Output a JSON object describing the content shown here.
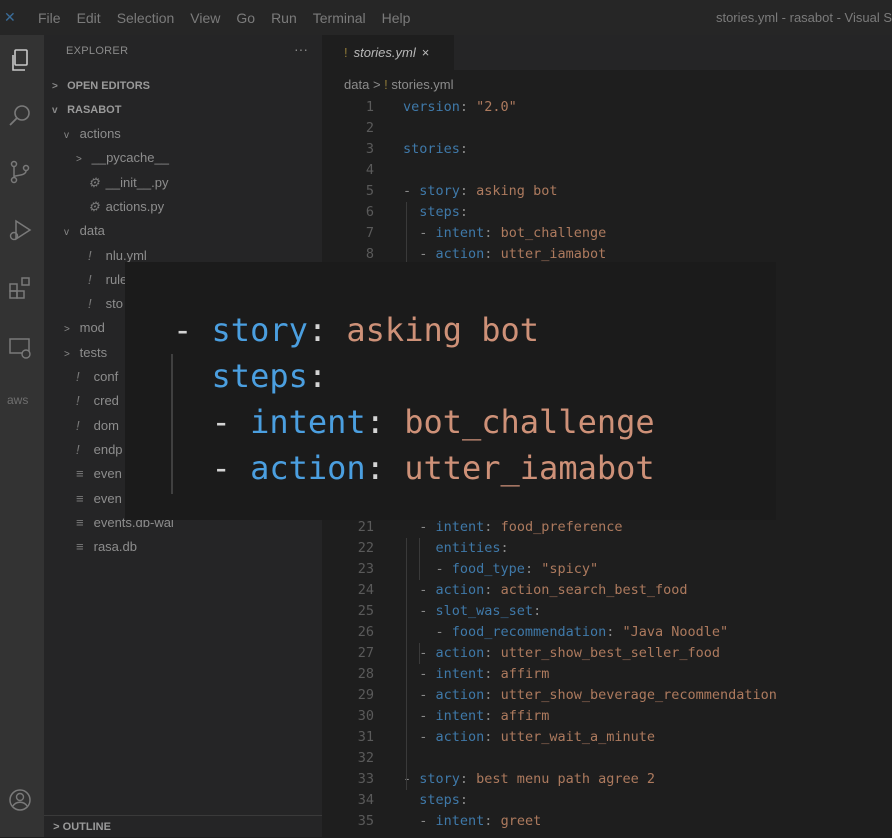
{
  "titlebar": {
    "menus": [
      "File",
      "Edit",
      "Selection",
      "View",
      "Go",
      "Run",
      "Terminal",
      "Help"
    ],
    "window_title": "stories.yml - rasabot - Visual S"
  },
  "activity_icons": [
    "explorer-icon",
    "search-icon",
    "source-control-icon",
    "run-debug-icon",
    "extensions-icon",
    "remote-explorer-icon",
    "aws-icon",
    "account-icon"
  ],
  "activity_aws_label": "aws",
  "explorer": {
    "header": "EXPLORER",
    "more": "···",
    "open_editors": "OPEN EDITORS",
    "root": "RASABOT",
    "outline": "OUTLINE",
    "items": [
      {
        "label": "actions",
        "twisty": "v",
        "icon": "",
        "indent": 1
      },
      {
        "label": "__pycache__",
        "twisty": ">",
        "icon": "",
        "indent": 2
      },
      {
        "label": "__init__.py",
        "twisty": "",
        "icon": "py",
        "indent": 2
      },
      {
        "label": "actions.py",
        "twisty": "",
        "icon": "py",
        "indent": 2
      },
      {
        "label": "data",
        "twisty": "v",
        "icon": "",
        "indent": 1
      },
      {
        "label": "nlu.yml",
        "twisty": "",
        "icon": "!",
        "indent": 2
      },
      {
        "label": "rule",
        "twisty": "",
        "icon": "!",
        "indent": 2
      },
      {
        "label": "sto",
        "twisty": "",
        "icon": "!",
        "indent": 2
      },
      {
        "label": "mod",
        "twisty": ">",
        "icon": "",
        "indent": 1
      },
      {
        "label": "tests",
        "twisty": ">",
        "icon": "",
        "indent": 1
      },
      {
        "label": "conf",
        "twisty": "",
        "icon": "!",
        "indent": 1
      },
      {
        "label": "cred",
        "twisty": "",
        "icon": "!",
        "indent": 1
      },
      {
        "label": "dom",
        "twisty": "",
        "icon": "!",
        "indent": 1
      },
      {
        "label": "endp",
        "twisty": "",
        "icon": "!",
        "indent": 1
      },
      {
        "label": "even",
        "twisty": "",
        "icon": "≡",
        "indent": 1
      },
      {
        "label": "even",
        "twisty": "",
        "icon": "≡",
        "indent": 1
      },
      {
        "label": "events.db-wal",
        "twisty": "",
        "icon": "≡",
        "indent": 1
      },
      {
        "label": "rasa.db",
        "twisty": "",
        "icon": "≡",
        "indent": 1
      }
    ]
  },
  "tab": {
    "icon": "!",
    "label": "stories.yml",
    "close": "×"
  },
  "breadcrumb": {
    "folder": "data",
    "sep": ">",
    "icon": "!",
    "file": "stories.yml"
  },
  "code_lines": [
    {
      "n": "1",
      "parts": [
        [
          "k",
          "version"
        ],
        [
          "d",
          ": "
        ],
        [
          "v",
          "\"2.0\""
        ]
      ]
    },
    {
      "n": "2",
      "parts": []
    },
    {
      "n": "3",
      "parts": [
        [
          "k",
          "stories"
        ],
        [
          "d",
          ":"
        ]
      ]
    },
    {
      "n": "4",
      "parts": []
    },
    {
      "n": "5",
      "parts": [
        [
          "d",
          "- "
        ],
        [
          "k",
          "story"
        ],
        [
          "d",
          ": "
        ],
        [
          "v",
          "asking bot"
        ]
      ]
    },
    {
      "n": "6",
      "parts": [
        [
          "d",
          "  "
        ],
        [
          "k",
          "steps"
        ],
        [
          "d",
          ":"
        ]
      ]
    },
    {
      "n": "7",
      "parts": [
        [
          "d",
          "  - "
        ],
        [
          "k",
          "intent"
        ],
        [
          "d",
          ": "
        ],
        [
          "v",
          "bot_challenge"
        ]
      ]
    },
    {
      "n": "8",
      "parts": [
        [
          "d",
          "  - "
        ],
        [
          "k",
          "action"
        ],
        [
          "d",
          ": "
        ],
        [
          "v",
          "utter_iamabot"
        ]
      ]
    },
    {
      "n": "21",
      "parts": [
        [
          "d",
          "  - "
        ],
        [
          "k",
          "intent"
        ],
        [
          "d",
          ": "
        ],
        [
          "v",
          "food_preference"
        ]
      ]
    },
    {
      "n": "22",
      "parts": [
        [
          "d",
          "    "
        ],
        [
          "k",
          "entities"
        ],
        [
          "d",
          ":"
        ]
      ]
    },
    {
      "n": "23",
      "parts": [
        [
          "d",
          "    - "
        ],
        [
          "k",
          "food_type"
        ],
        [
          "d",
          ": "
        ],
        [
          "v",
          "\"spicy\""
        ]
      ]
    },
    {
      "n": "24",
      "parts": [
        [
          "d",
          "  - "
        ],
        [
          "k",
          "action"
        ],
        [
          "d",
          ": "
        ],
        [
          "v",
          "action_search_best_food"
        ]
      ]
    },
    {
      "n": "25",
      "parts": [
        [
          "d",
          "  - "
        ],
        [
          "k",
          "slot_was_set"
        ],
        [
          "d",
          ":"
        ]
      ]
    },
    {
      "n": "26",
      "parts": [
        [
          "d",
          "    - "
        ],
        [
          "k",
          "food_recommendation"
        ],
        [
          "d",
          ": "
        ],
        [
          "v",
          "\"Java Noodle\""
        ]
      ]
    },
    {
      "n": "27",
      "parts": [
        [
          "d",
          "  - "
        ],
        [
          "k",
          "action"
        ],
        [
          "d",
          ": "
        ],
        [
          "v",
          "utter_show_best_seller_food"
        ]
      ]
    },
    {
      "n": "28",
      "parts": [
        [
          "d",
          "  - "
        ],
        [
          "k",
          "intent"
        ],
        [
          "d",
          ": "
        ],
        [
          "v",
          "affirm"
        ]
      ]
    },
    {
      "n": "29",
      "parts": [
        [
          "d",
          "  - "
        ],
        [
          "k",
          "action"
        ],
        [
          "d",
          ": "
        ],
        [
          "v",
          "utter_show_beverage_recommendation"
        ]
      ]
    },
    {
      "n": "30",
      "parts": [
        [
          "d",
          "  - "
        ],
        [
          "k",
          "intent"
        ],
        [
          "d",
          ": "
        ],
        [
          "v",
          "affirm"
        ]
      ]
    },
    {
      "n": "31",
      "parts": [
        [
          "d",
          "  - "
        ],
        [
          "k",
          "action"
        ],
        [
          "d",
          ": "
        ],
        [
          "v",
          "utter_wait_a_minute"
        ]
      ]
    },
    {
      "n": "32",
      "parts": []
    },
    {
      "n": "33",
      "parts": [
        [
          "d",
          "- "
        ],
        [
          "k",
          "story"
        ],
        [
          "d",
          ": "
        ],
        [
          "v",
          "best menu path agree 2"
        ]
      ]
    },
    {
      "n": "34",
      "parts": [
        [
          "d",
          "  "
        ],
        [
          "k",
          "steps"
        ],
        [
          "d",
          ":"
        ]
      ]
    },
    {
      "n": "35",
      "parts": [
        [
          "d",
          "  - "
        ],
        [
          "k",
          "intent"
        ],
        [
          "d",
          ": "
        ],
        [
          "v",
          "greet"
        ]
      ]
    }
  ],
  "zoom": {
    "lines": [
      [
        [
          "zd",
          "- "
        ],
        [
          "zk",
          "story"
        ],
        [
          "zd",
          ": "
        ],
        [
          "zv",
          "asking bot"
        ]
      ],
      [
        [
          "zd",
          "  "
        ],
        [
          "zk",
          "steps"
        ],
        [
          "zd",
          ":"
        ]
      ],
      [
        [
          "zd",
          "  - "
        ],
        [
          "zk",
          "intent"
        ],
        [
          "zd",
          ": "
        ],
        [
          "zv",
          "bot_challenge"
        ]
      ],
      [
        [
          "zd",
          "  - "
        ],
        [
          "zk",
          "action"
        ],
        [
          "zd",
          ": "
        ],
        [
          "zv",
          "utter_iamabot"
        ]
      ]
    ]
  }
}
